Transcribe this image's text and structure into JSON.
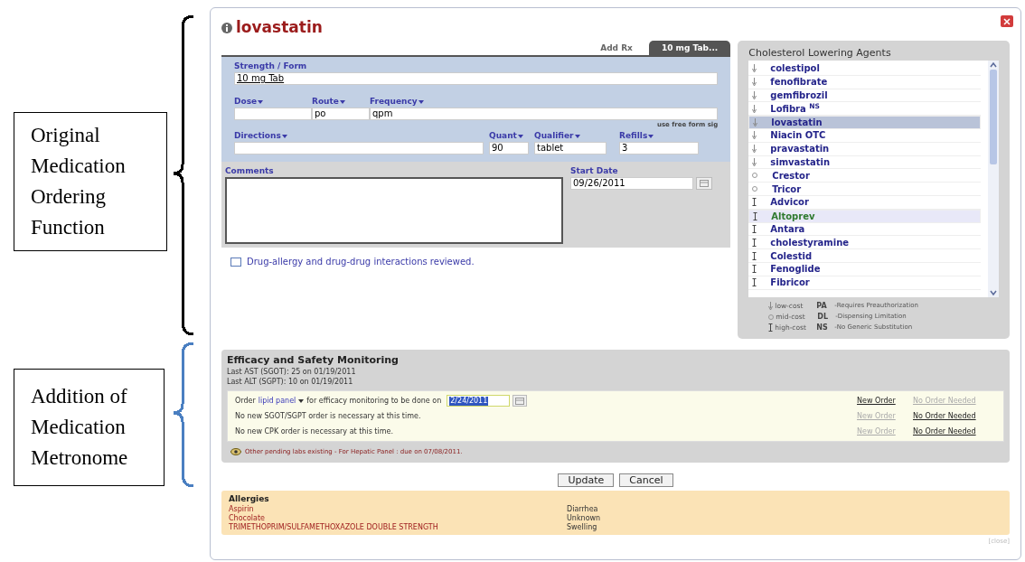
{
  "annotations": [
    {
      "label": "Original Medication Ordering Function",
      "color": "#000000"
    },
    {
      "label": "Addition of Medication Metronome",
      "color": "#4a7fc1"
    }
  ],
  "dialog": {
    "title": "lovastatin",
    "close_label": "[close]",
    "tabs": [
      {
        "label": "Add Rx",
        "selected": false
      },
      {
        "label": "10 mg Tab...",
        "selected": true
      }
    ],
    "form": {
      "strength_label": "Strength / Form",
      "strength": "10 mg Tab",
      "dose_label": "Dose",
      "route_label": "Route",
      "route": "po",
      "frequency_label": "Frequency",
      "frequency": "qpm",
      "free_form": "use free form sig",
      "directions_label": "Directions",
      "quantity_label": "Quant",
      "quantity": "90",
      "qualifier_label": "Qualifier",
      "qualifier": "tablet",
      "refills_label": "Refills",
      "refills": "3",
      "comments_label": "Comments",
      "start_date_label": "Start Date",
      "start_date": "09/26/2011",
      "reviewed_label": "Drug-allergy and drug-drug interactions reviewed.",
      "reviewed_checked": false
    },
    "drug_list": {
      "title": "Cholesterol Lowering Agents",
      "items": [
        {
          "name": "colestipol",
          "kind": "low",
          "selected": false,
          "highlighted": false
        },
        {
          "name": "fenofibrate",
          "kind": "low",
          "selected": false,
          "highlighted": false
        },
        {
          "name": "gemfibrozil",
          "kind": "low",
          "selected": false,
          "highlighted": false
        },
        {
          "name": "Lofibra $^{NS}$",
          "kind": "low",
          "selected": false,
          "highlighted": false
        },
        {
          "name": "lovastatin",
          "kind": "low",
          "selected": true,
          "highlighted": false
        },
        {
          "name": "Niacin OTC",
          "kind": "low",
          "selected": false,
          "highlighted": false
        },
        {
          "name": "pravastatin",
          "kind": "low",
          "selected": false,
          "highlighted": false
        },
        {
          "name": "simvastatin",
          "kind": "low",
          "selected": false,
          "highlighted": false
        },
        {
          "name": "Crestor",
          "kind": "mid",
          "selected": false,
          "highlighted": false
        },
        {
          "name": "Tricor",
          "kind": "mid",
          "selected": false,
          "highlighted": false
        },
        {
          "name": "Advicor",
          "kind": "high",
          "selected": false,
          "highlighted": false
        },
        {
          "name": "Altoprev",
          "kind": "high",
          "selected": false,
          "highlighted": true
        },
        {
          "name": "Antara",
          "kind": "high",
          "selected": false,
          "highlighted": false
        },
        {
          "name": "cholestyramine",
          "kind": "high",
          "selected": false,
          "highlighted": false
        },
        {
          "name": "Colestid",
          "kind": "high",
          "selected": false,
          "highlighted": false
        },
        {
          "name": "Fenoglide",
          "kind": "high",
          "selected": false,
          "highlighted": false
        },
        {
          "name": "Fibricor",
          "kind": "high",
          "selected": false,
          "highlighted": false
        }
      ],
      "legend": [
        {
          "kind": "low",
          "cost": "low-cost",
          "code": "PA",
          "meaning": "-Requires Preauthorization"
        },
        {
          "kind": "mid",
          "cost": "mid-cost",
          "code": "DL",
          "meaning": "-Dispensing Limitation"
        },
        {
          "kind": "high",
          "cost": "high-cost",
          "code": "NS",
          "meaning": "-No Generic Substitution"
        }
      ]
    },
    "monitoring": {
      "title": "Efficacy and Safety Monitoring",
      "last_labs": [
        "Last AST (SGOT): 25 on 01/19/2011",
        "Last ALT (SGPT): 10 on 01/19/2011"
      ],
      "rows": [
        {
          "kind": "order",
          "prefix": "Order",
          "test": "lipid panel",
          "suffix": "for efficacy monitoring to be done on",
          "date": "2/24/2011",
          "new_order": {
            "label": "New Order",
            "selected": true
          },
          "no_order": {
            "label": "No Order Needed",
            "selected": false
          }
        },
        {
          "kind": "note",
          "text": "No new SGOT/SGPT order is necessary at this time.",
          "new_order": {
            "label": "New Order",
            "selected": false
          },
          "no_order": {
            "label": "No Order Needed",
            "selected": true
          }
        },
        {
          "kind": "note",
          "text": "No new CPK order is necessary at this time.",
          "new_order": {
            "label": "New Order",
            "selected": false
          },
          "no_order": {
            "label": "No Order Needed",
            "selected": true
          }
        }
      ],
      "pending": "Other pending labs existing - For Hepatic Panel : due on 07/08/2011."
    },
    "buttons": [
      "Update",
      "Cancel"
    ],
    "allergies": {
      "title": "Allergies",
      "items": [
        {
          "allergen": "Aspirin",
          "reaction": "Diarrhea"
        },
        {
          "allergen": "Chocolate",
          "reaction": "Unknown"
        },
        {
          "allergen": "TRIMETHOPRIM/SULFAMETHOXAZOLE DOUBLE STRENGTH",
          "reaction": "Swelling"
        }
      ]
    }
  }
}
